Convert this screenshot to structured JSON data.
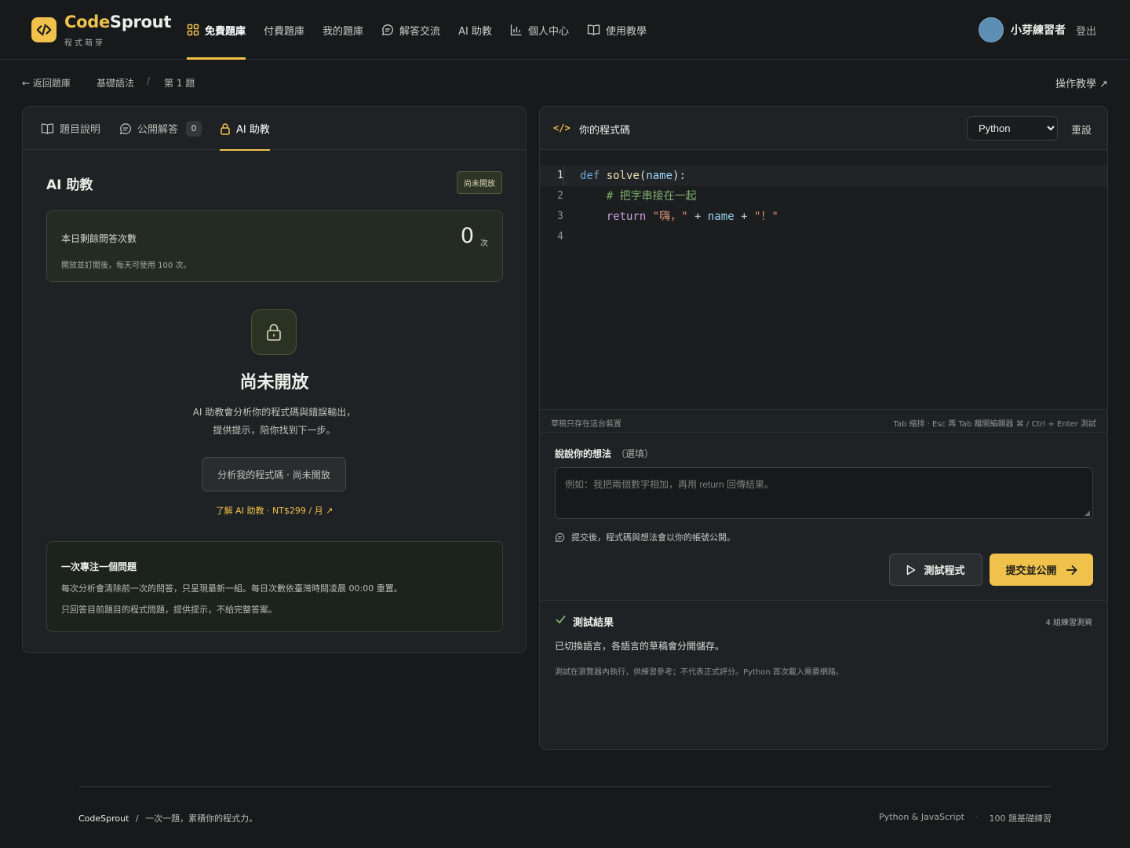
{
  "brand": {
    "name_part1": "Code",
    "name_part2": "Sprout",
    "subtitle": "程式萌芽",
    "accent": "#f0c24b"
  },
  "nav": {
    "items": [
      {
        "label": "免費題庫",
        "icon": "grid-icon",
        "active": true
      },
      {
        "label": "付費題庫",
        "icon": "",
        "active": false
      },
      {
        "label": "我的題庫",
        "icon": "",
        "active": false
      },
      {
        "label": "解答交流",
        "icon": "chat-icon",
        "active": false
      },
      {
        "label": "AI 助教",
        "icon": "",
        "active": false
      },
      {
        "label": "個人中心",
        "icon": "bar-chart-icon",
        "active": false
      },
      {
        "label": "使用教學",
        "icon": "book-icon",
        "active": false
      }
    ],
    "user_name": "小芽練習者",
    "logout_label": "登出"
  },
  "breadcrumb": {
    "back_label": "← 返回題庫",
    "category": "基礎語法",
    "separator": "/",
    "current": "第 1 題",
    "help_label": "操作教學 ↗"
  },
  "left_panel": {
    "tabs": [
      {
        "label": "題目說明",
        "icon": "book-icon"
      },
      {
        "label": "公開解答",
        "icon": "chat-icon",
        "count": "0"
      },
      {
        "label": "AI 助教",
        "icon": "lock-icon",
        "active": true
      }
    ],
    "title": "AI 助教",
    "status_badge": "尚未開放",
    "quota": {
      "label": "本日剩餘問答次數",
      "value": "0",
      "unit": "次",
      "note": "開放並訂閱後，每天可使用 100 次。"
    },
    "locked": {
      "heading": "尚未開放",
      "desc_line1": "AI 助教會分析你的程式碼與錯誤輸出，",
      "desc_line2": "提供提示，陪你找到下一步。",
      "button_label": "分析我的程式碼 · 尚未開放",
      "learn_link": "了解 AI 助教 · NT$299 / 月 ↗"
    },
    "focus": {
      "title": "一次專注一個問題",
      "line1": "每次分析會清除前一次的問答，只呈現最新一組。每日次數依臺灣時間凌晨 00:00 重置。",
      "line2": "只回答目前題目的程式問題，提供提示，不給完整答案。"
    }
  },
  "editor": {
    "icon_text": "</>",
    "title": "你的程式碼",
    "language": "Python",
    "language_options": [
      "Python",
      "JavaScript"
    ],
    "reset_label": "重設",
    "lines": [
      {
        "num": "1"
      },
      {
        "num": "2"
      },
      {
        "num": "3"
      },
      {
        "num": "4"
      }
    ],
    "code": {
      "l1_kw": "def",
      "l1_fn": "solve",
      "l1_param": "name",
      "l1_open": "(",
      "l1_close": "):",
      "l2_comment": "# 把字串接在一起",
      "l3_kw": "return",
      "l3_str1": "\"嗨，\"",
      "l3_plus1": "+",
      "l3_id": "name",
      "l3_plus2": "+",
      "l3_str2": "\"！\""
    },
    "footer_left": "草稿只存在這台裝置",
    "footer_right": "Tab 縮排 · Esc 再 Tab 離開編輯器    ⌘ / Ctrl + Enter 測試"
  },
  "thoughts": {
    "label": "說說你的想法",
    "optional": "（選填）",
    "placeholder": "例如：我把兩個數字相加，再用 return 回傳結果。",
    "value": "",
    "public_note": "提交後，程式碼與想法會以你的帳號公開。"
  },
  "actions": {
    "test_label": "測試程式",
    "submit_label": "提交並公開"
  },
  "results": {
    "title": "測試結果",
    "count": "4 組練習測資",
    "message": "已切換語言，各語言的草稿會分開儲存。",
    "note": "測試在瀏覽器內執行，供練習參考；不代表正式評分。Python 首次載入需要網路。"
  },
  "footer": {
    "brand": "CodeSprout",
    "separator": "/",
    "tagline": "一次一題，累積你的程式力。",
    "right1": "Python & JavaScript",
    "right_sep": "·",
    "right2": "100 題基礎練習"
  }
}
